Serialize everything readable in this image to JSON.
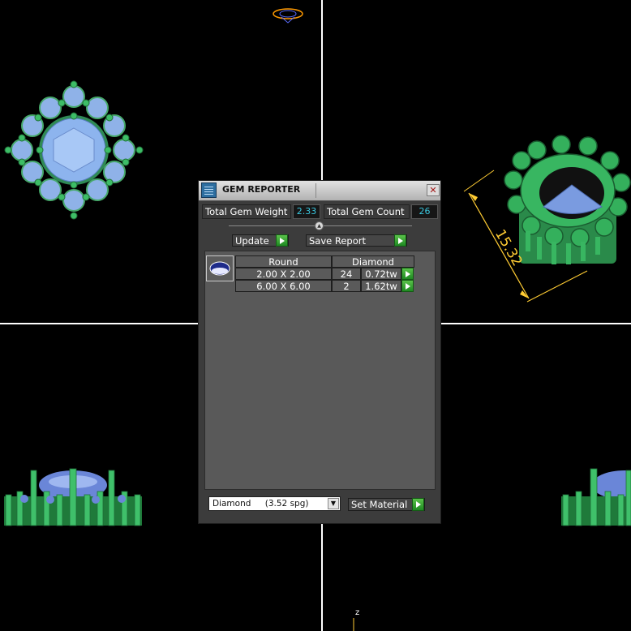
{
  "viewport": {
    "dimension_label": "15.32",
    "axis_label": "z"
  },
  "dialog": {
    "title": "GEM REPORTER",
    "close_glyph": "✕",
    "total_weight_label": "Total Gem Weight",
    "total_weight_value": "2.33",
    "total_count_label": "Total Gem Count",
    "total_count_value": "26",
    "update_label": "Update",
    "save_report_label": "Save Report",
    "table": {
      "headers": [
        "Round",
        "Diamond"
      ],
      "rows": [
        {
          "size": "2.00 X 2.00",
          "count": "24",
          "weight": "0.72tw"
        },
        {
          "size": "6.00 X 6.00",
          "count": "2",
          "weight": "1.62tw"
        }
      ]
    },
    "material_select": {
      "name": "Diamond",
      "spg": "(3.52 spg)"
    },
    "set_material_label": "Set Material"
  },
  "icons": {
    "title": "gem-reporter-icon",
    "close": "close-icon",
    "go": "green-arrow-icon",
    "gem_thumb": "oval-gem-icon",
    "dropdown": "chevron-down-icon"
  }
}
